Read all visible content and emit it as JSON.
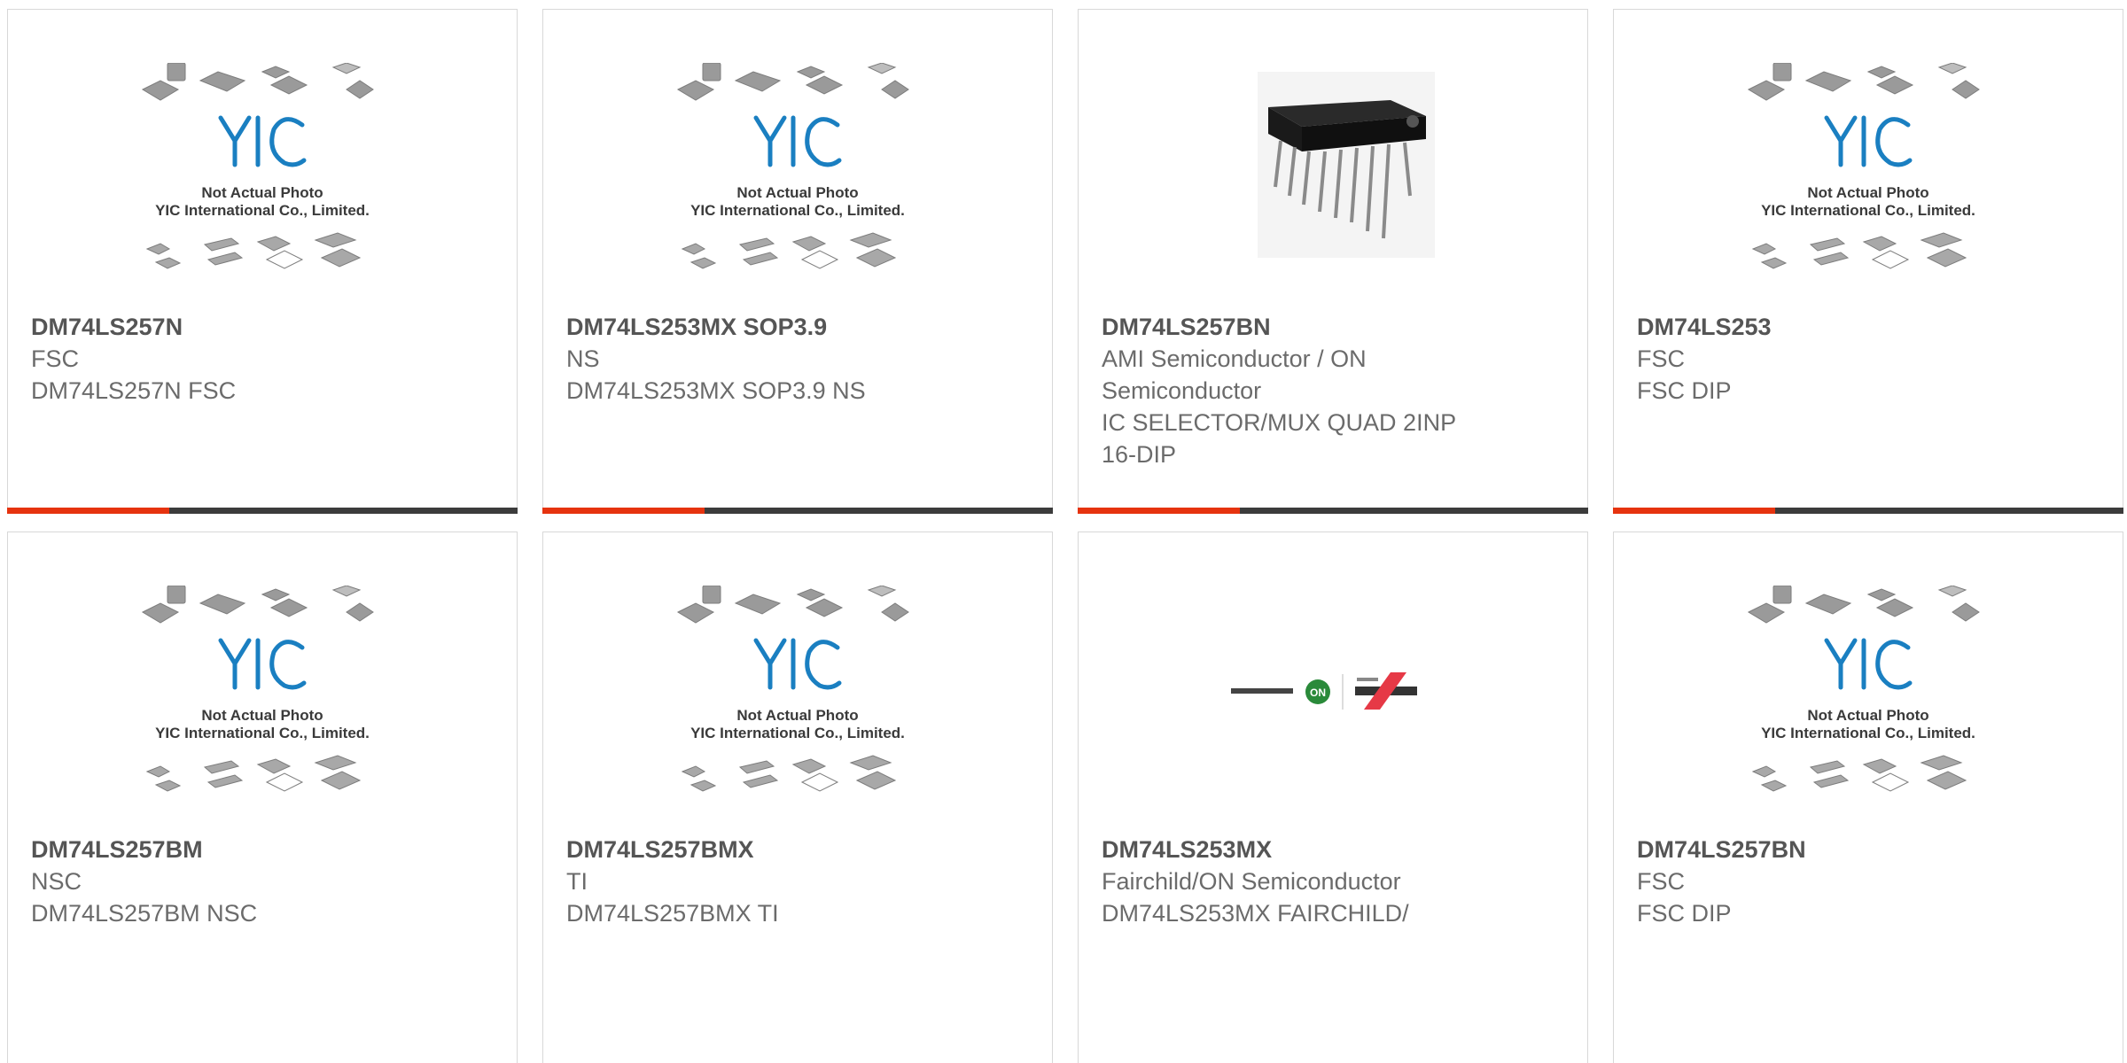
{
  "colors": {
    "accent_bar": "#e6330f",
    "dark_bar": "#3c3c3c",
    "logo_blue": "#1a7fc1",
    "title_text": "#555555",
    "body_text": "#6b6b6b"
  },
  "placeholder": {
    "line1": "Not Actual Photo",
    "line2": "YIC International Co., Limited."
  },
  "products": [
    {
      "title": "DM74LS257N",
      "lines": [
        "FSC",
        "DM74LS257N FSC"
      ],
      "image": "placeholder"
    },
    {
      "title": "DM74LS253MX SOP3.9",
      "lines": [
        "NS",
        "DM74LS253MX SOP3.9 NS"
      ],
      "image": "placeholder"
    },
    {
      "title": "DM74LS257BN",
      "lines": [
        "AMI Semiconductor / ON",
        "Semiconductor",
        "IC SELECTOR/MUX QUAD 2INP",
        "16-DIP"
      ],
      "image": "dip-chip-photo"
    },
    {
      "title": "DM74LS253",
      "lines": [
        "FSC",
        "FSC DIP"
      ],
      "image": "placeholder"
    },
    {
      "title": "DM74LS257BM",
      "lines": [
        "NSC",
        "DM74LS257BM NSC"
      ],
      "image": "placeholder"
    },
    {
      "title": "DM74LS257BMX",
      "lines": [
        "TI",
        "DM74LS257BMX TI"
      ],
      "image": "placeholder"
    },
    {
      "title": "DM74LS253MX",
      "lines": [
        "Fairchild/ON Semiconductor",
        "DM74LS253MX FAIRCHILD/"
      ],
      "image": "on-fairchild-logo"
    },
    {
      "title": "DM74LS257BN",
      "lines": [
        "FSC",
        "FSC DIP"
      ],
      "image": "placeholder"
    }
  ]
}
